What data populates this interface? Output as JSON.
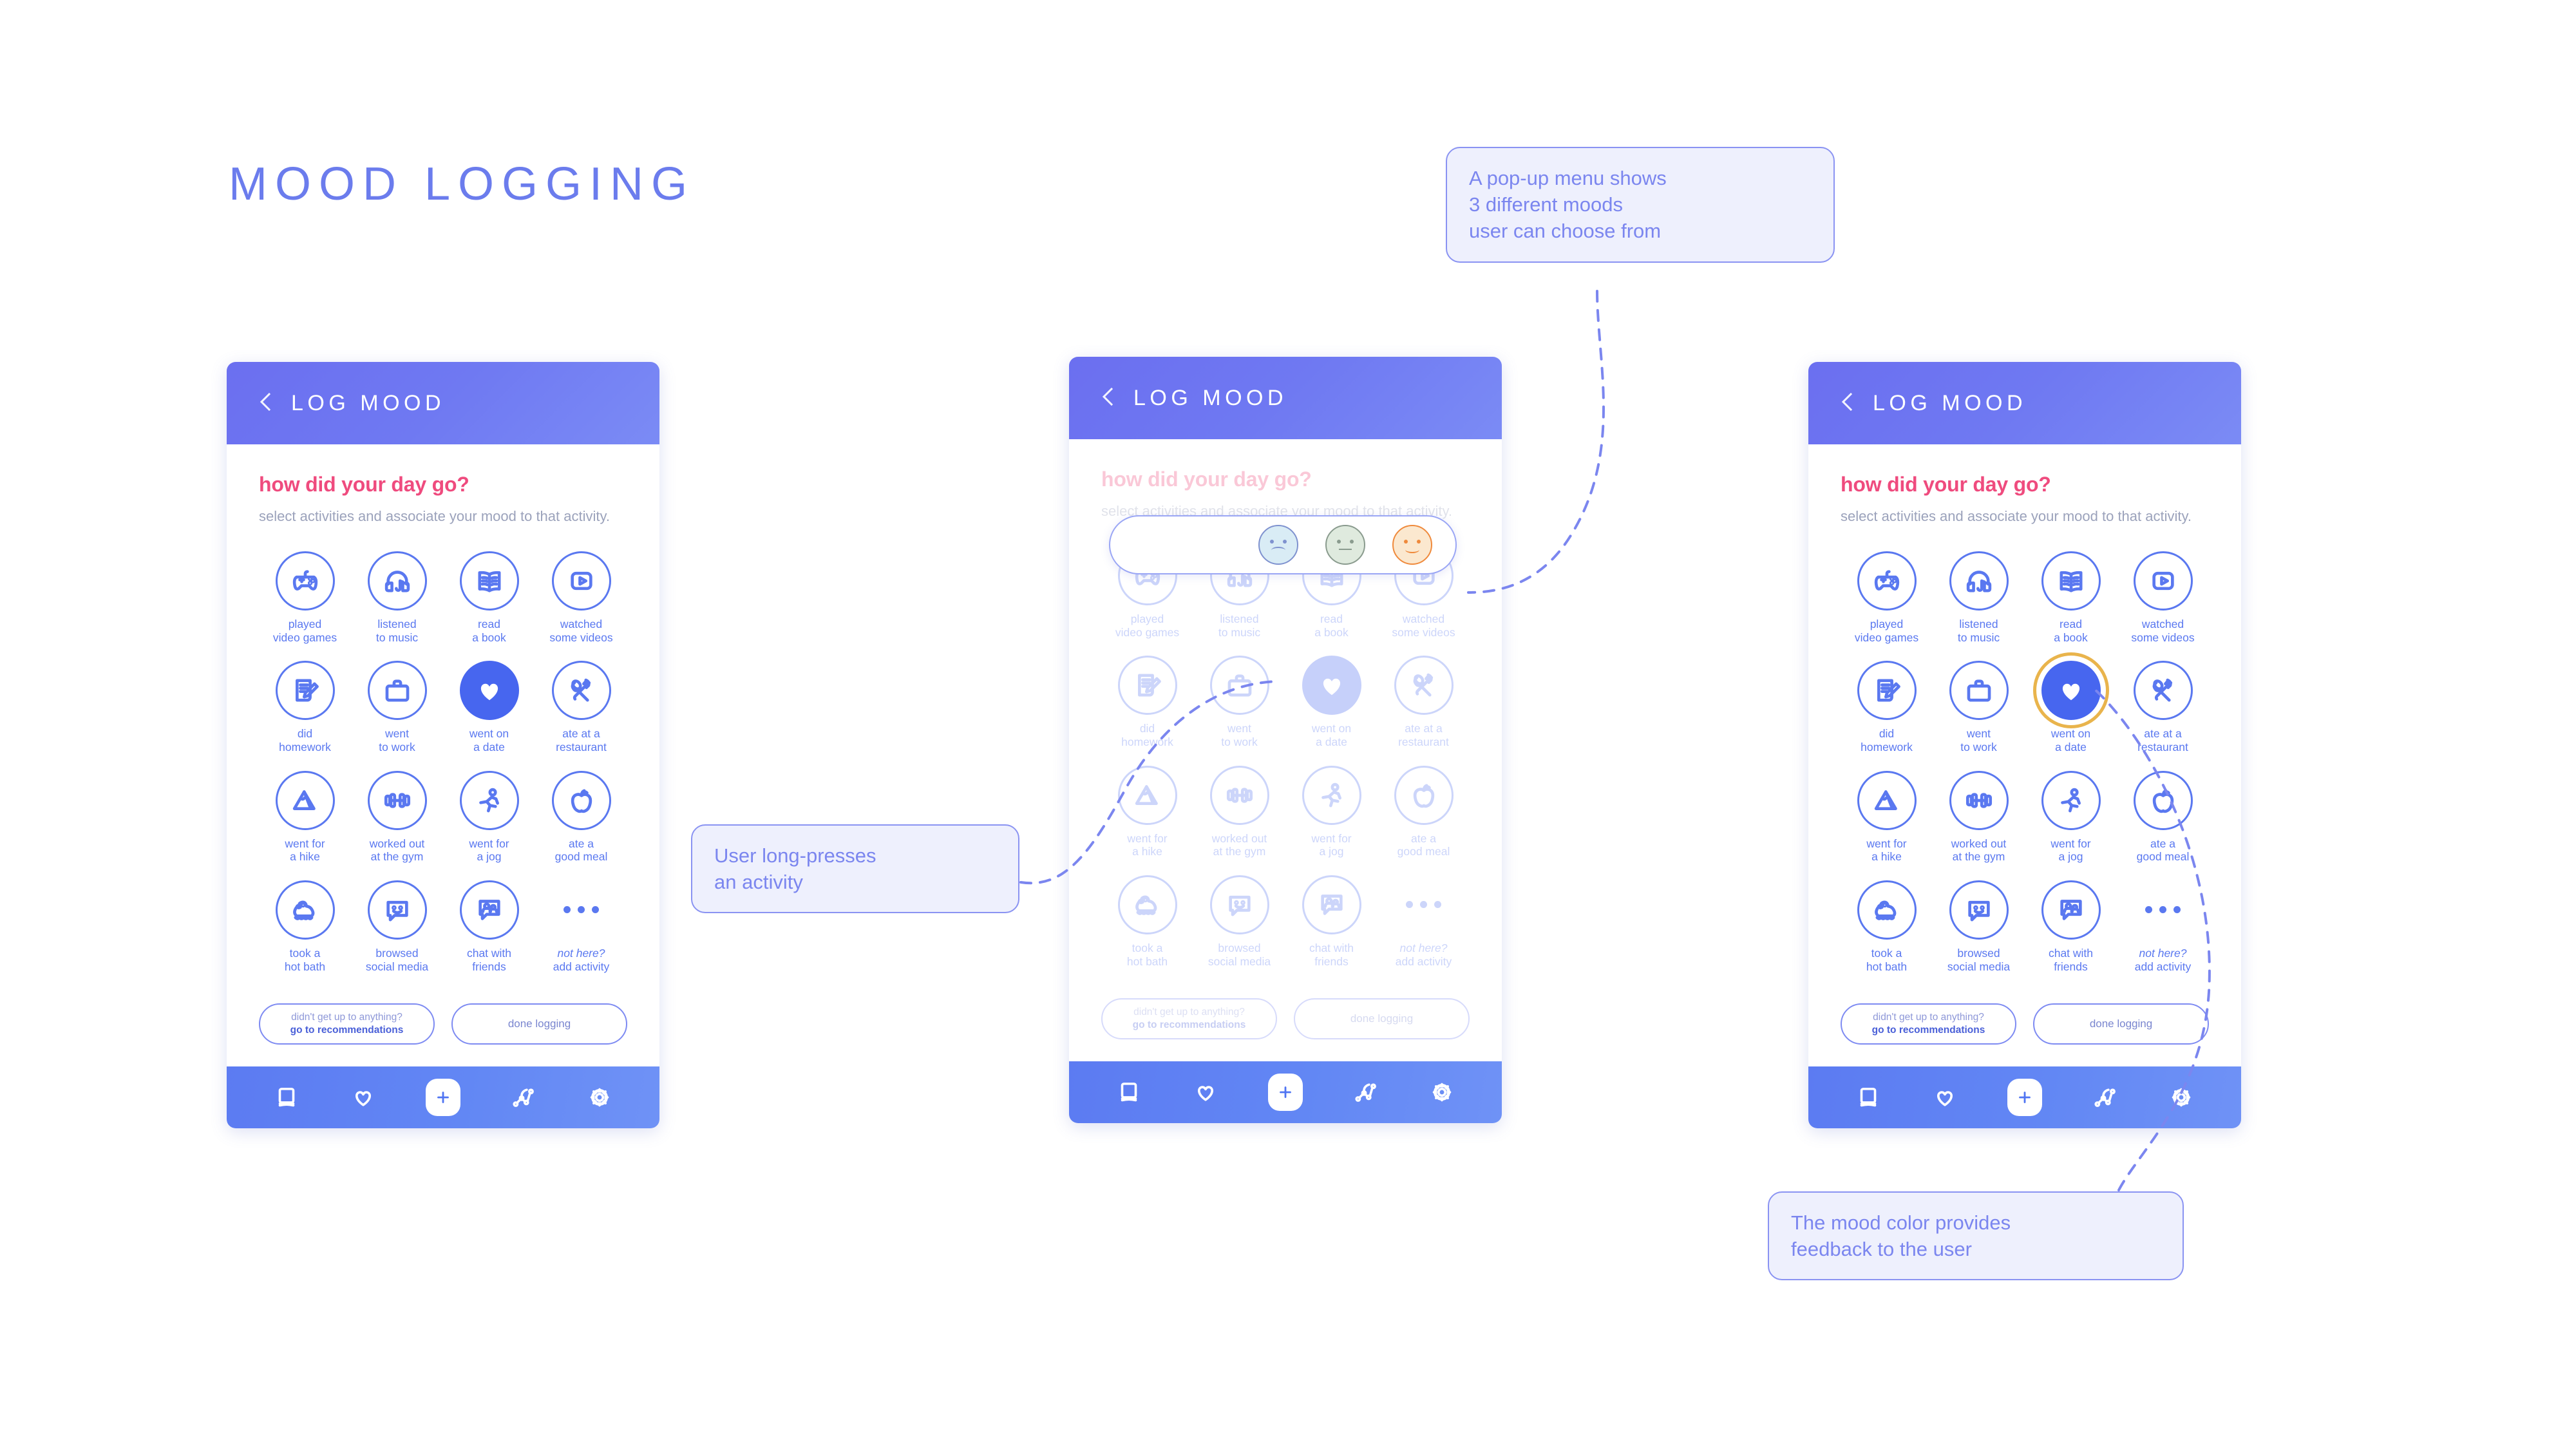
{
  "page": {
    "title": "MOOD LOGGING"
  },
  "screen": {
    "header_title": "LOG MOOD",
    "back_icon": "back-chevron-icon",
    "question": "how did your day go?",
    "subtitle": "select activities and associate\nyour mood to that activity.",
    "buttons": {
      "recommend_line1": "didn't get up to anything?",
      "recommend_line2": "go to recommendations",
      "done": "done logging"
    },
    "nav_items": [
      "journal-icon",
      "heart-icon",
      "plus-icon",
      "trends-icon",
      "gear-icon"
    ]
  },
  "activities": [
    {
      "id": "played-video-games",
      "icon": "gamepad-icon",
      "label": "played\nvideo games"
    },
    {
      "id": "listened-to-music",
      "icon": "headphones-icon",
      "label": "listened\nto music"
    },
    {
      "id": "read-a-book",
      "icon": "open-book-icon",
      "label": "read\na book"
    },
    {
      "id": "watched-some-videos",
      "icon": "play-video-icon",
      "label": "watched\nsome videos"
    },
    {
      "id": "did-homework",
      "icon": "notepad-pencil-icon",
      "label": "did\nhomework"
    },
    {
      "id": "went-to-work",
      "icon": "briefcase-icon",
      "label": "went\nto work"
    },
    {
      "id": "went-on-a-date",
      "icon": "heart-icon",
      "label": "went on\na date"
    },
    {
      "id": "ate-at-a-restaurant",
      "icon": "spoon-fork-icon",
      "label": "ate at a\nrestaurant"
    },
    {
      "id": "went-for-a-hike",
      "icon": "mountain-icon",
      "label": "went for\na hike"
    },
    {
      "id": "worked-out-at-gym",
      "icon": "dumbbell-icon",
      "label": "worked out\nat the gym"
    },
    {
      "id": "went-for-a-jog",
      "icon": "runner-icon",
      "label": "went for\na jog"
    },
    {
      "id": "ate-a-good-meal",
      "icon": "apple-icon",
      "label": "ate a\ngood meal"
    },
    {
      "id": "took-a-hot-bath",
      "icon": "rubber-duck-icon",
      "label": "took a\nhot bath"
    },
    {
      "id": "browsed-social-media",
      "icon": "smiley-chat-icon",
      "label": "browsed\nsocial media"
    },
    {
      "id": "chat-with-friends",
      "icon": "people-chat-icon",
      "label": "chat with\nfriends"
    },
    {
      "id": "add-activity",
      "icon": "ellipsis-icon",
      "label": "not here?\nadd activity"
    }
  ],
  "moods": [
    {
      "id": "sad",
      "icon": "sad-face-icon",
      "color": "#7f92cf",
      "fill": "#d9ecf5"
    },
    {
      "id": "neutral",
      "icon": "neutral-face-icon",
      "color": "#8a9b8e",
      "fill": "#dfeade"
    },
    {
      "id": "happy",
      "icon": "happy-face-icon",
      "color": "#ef8a3c",
      "fill": "#fbe8cf"
    }
  ],
  "selection": {
    "selected_activity": "went-on-a-date",
    "selected_fill": "#4766ef",
    "mood_ring_color": "#e9b44c"
  },
  "callouts": [
    {
      "id": "popup-menu-note",
      "text": "A pop-up menu shows\n3 different moods\nuser can choose from"
    },
    {
      "id": "long-press-note",
      "text": "User long-presses\nan activity"
    },
    {
      "id": "mood-color-note",
      "text": "The mood color provides\nfeedback to the user"
    }
  ],
  "colors": {
    "accent_purple": "#6b7ced",
    "header_gradient_start": "#6b6ff0",
    "header_gradient_end": "#7b8bf5",
    "nav_blue": "#5c7bf2",
    "question_pink": "#ef4b7e",
    "icon_blue": "#5a78f0",
    "callout_bg": "#eef0fd"
  }
}
